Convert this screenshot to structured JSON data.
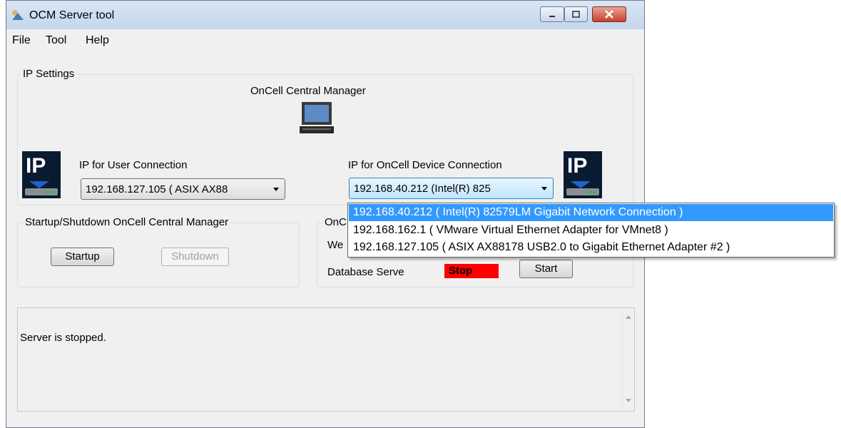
{
  "window": {
    "title": "OCM Server tool"
  },
  "menu": [
    "File",
    "Tool",
    "Help"
  ],
  "ip_settings": {
    "legend": "IP Settings",
    "manager_label": "OnCell Central Manager",
    "user_conn_label": "IP for User Connection",
    "user_conn_value": "192.168.127.105  ( ASIX AX88",
    "device_conn_label": "IP for OnCell Device Connection",
    "device_conn_value": "192.168.40.212  (Intel(R) 825",
    "ip_icon_text": "IP"
  },
  "startup_group": {
    "legend": "Startup/Shutdown OnCell Central Manager",
    "startup_label": "Startup",
    "shutdown_label": "Shutdown"
  },
  "status_group": {
    "legend": "OnC",
    "web_label": "We",
    "db_label": "Database Serve",
    "db_status": "Stop",
    "start_label": "Start"
  },
  "log": {
    "text": "Server is stopped."
  },
  "dropdown": {
    "options": [
      "192.168.40.212  ( Intel(R) 82579LM Gigabit Network Connection )",
      "192.168.162.1  ( VMware Virtual Ethernet Adapter for VMnet8 )",
      "192.168.127.105  ( ASIX AX88178 USB2.0 to Gigabit Ethernet Adapter #2 )"
    ]
  },
  "colors": {
    "status_stop": "#ff0000",
    "selection": "#3399ff"
  },
  "icons": [
    "app-icon",
    "monitor-icon",
    "ip-icon",
    "dropdown-arrow-icon",
    "scroll-up-icon",
    "scroll-down-icon"
  ]
}
